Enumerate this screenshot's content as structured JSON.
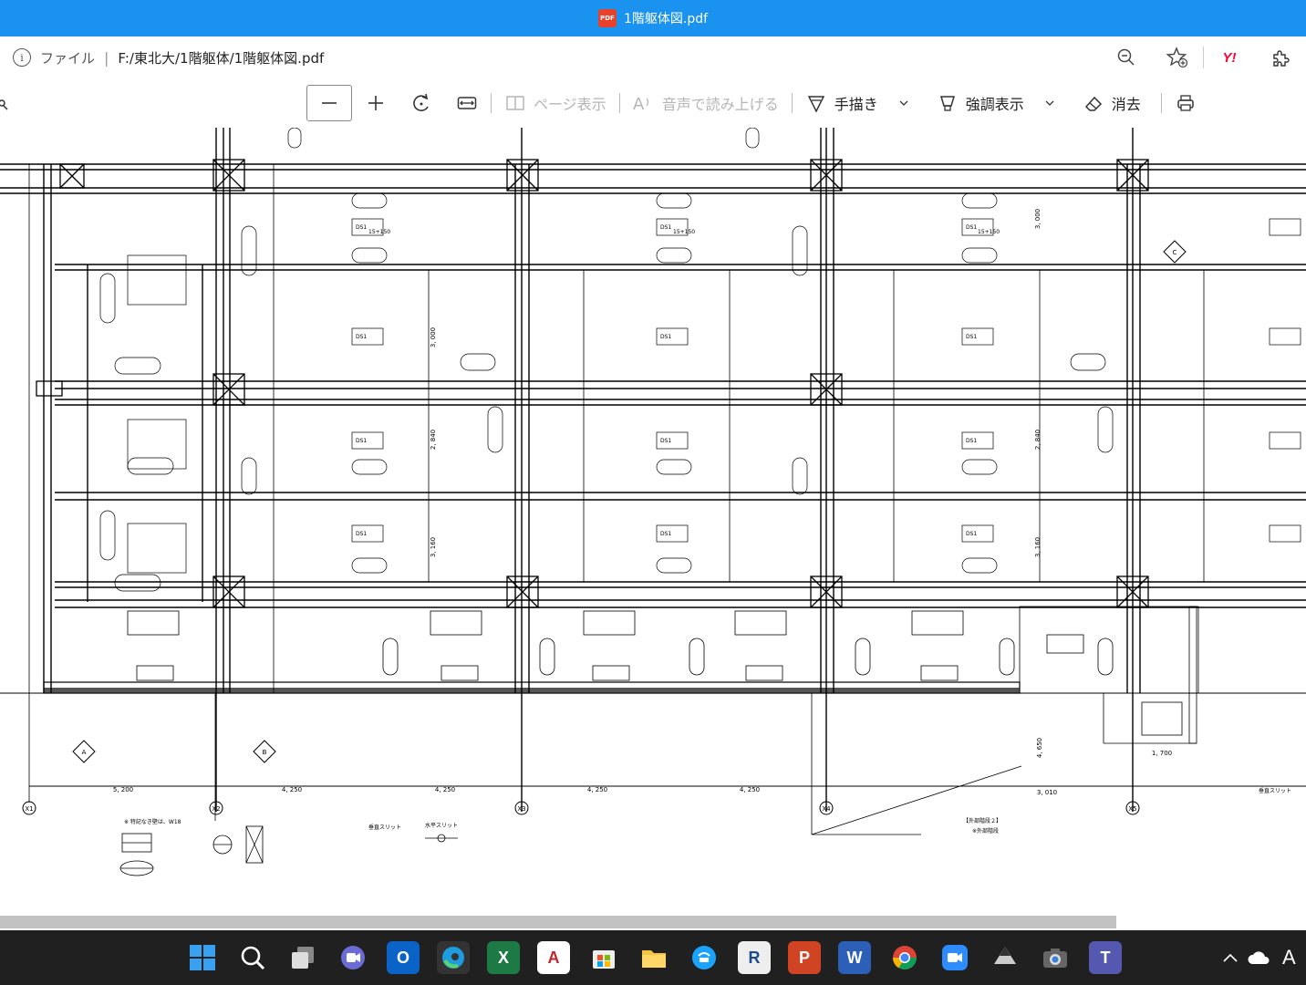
{
  "window": {
    "title": "1階躯体図.pdf",
    "pdf_badge": "PDF"
  },
  "address": {
    "info_glyph": "i",
    "scheme_label": "ファイル",
    "separator": "|",
    "url": "F:/東北大/1階躯体/1階躯体図.pdf",
    "yahoo_label": "Y!"
  },
  "toolbar": {
    "page_view": "ページ表示",
    "read_aloud": "音声で読み上げる",
    "draw": "手描き",
    "highlight": "強調表示",
    "erase": "消去"
  },
  "drawing": {
    "grid_labels": [
      "X1",
      "X2",
      "X3",
      "X4",
      "X5"
    ],
    "spans": [
      "5, 200",
      "4, 250",
      "4, 250",
      "4, 250",
      "4, 250"
    ],
    "heights": [
      "3, 000",
      "2, 840",
      "3, 160"
    ],
    "section_marks": [
      "A",
      "B",
      "C"
    ],
    "legend_title": "※ 特記なき壁は、W18",
    "slit_vertical_title": "垂直スリット",
    "slit_horizontal_title": "水平スリット",
    "stair_title": "【外部階段２】",
    "stair_note": "※外部階段",
    "labels_ds1": "DS1",
    "label_1515": "15+150",
    "stair_width": "3, 010",
    "stair_height": "4, 650",
    "stair_len": "1, 700"
  },
  "taskbar": {
    "items": [
      "windows-start",
      "search",
      "task-view",
      "meet",
      "outlook",
      "edge",
      "excel",
      "acrobat",
      "store",
      "file-explorer",
      "line",
      "revit",
      "powerpoint",
      "word",
      "chrome",
      "zoom",
      "inkscape",
      "camera",
      "teams"
    ],
    "ime_label": "A",
    "tray_chevron": "^"
  }
}
